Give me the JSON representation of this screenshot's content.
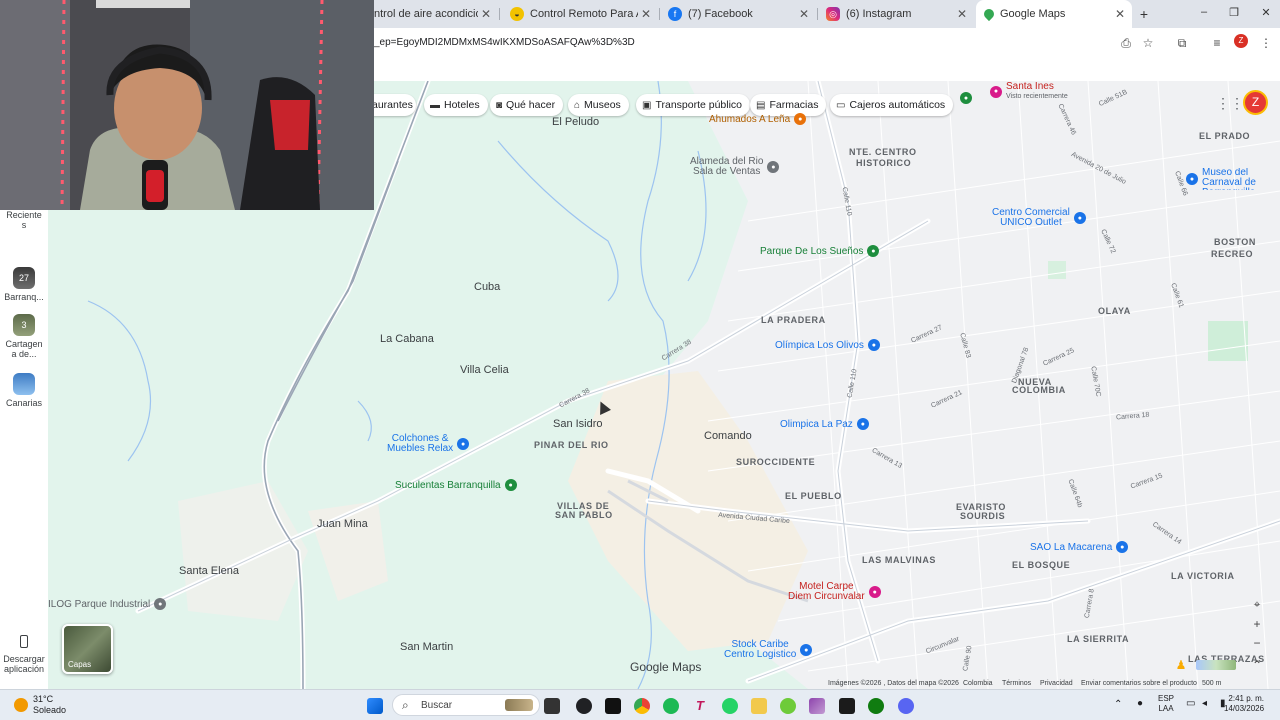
{
  "tabs": [
    {
      "label": "ntrol de aire acondicionado",
      "icon": "document-icon",
      "active": false
    },
    {
      "label": "Control Remoto Para Aire Acon",
      "icon": "shopping-icon",
      "active": false
    },
    {
      "label": "(7) Facebook",
      "icon": "facebook-icon",
      "active": false
    },
    {
      "label": "(6) Instagram",
      "icon": "instagram-icon",
      "active": false
    },
    {
      "label": "Google Maps",
      "icon": "maps-pin-icon",
      "active": true
    }
  ],
  "window": {
    "minimize": "–",
    "restore": "❐",
    "close": "✕",
    "new_tab": "+"
  },
  "omnibox": {
    "url": "_ep=EgoyMDI2MDMxMS4wIKXMDSoASAFQAw%3D%3D"
  },
  "profile_initial": "Z",
  "map": {
    "chips": [
      "aurantes",
      "Hoteles",
      "Qué hacer",
      "Museos",
      "Transporte público",
      "Farmacias",
      "Cajeros automáticos"
    ],
    "avatar_initial": "Z",
    "places": [
      "El Peludo",
      "Cuba",
      "La Cabana",
      "Villa Celia",
      "San Isidro",
      "Comando",
      "Juan Mina",
      "Santa Elena",
      "San Martin"
    ],
    "neighborhoods": [
      "NTE. CENTRO",
      "HISTORICO",
      "EL PRADO",
      "BOSTON",
      "RECREO",
      "OLAYA",
      "LA PRADERA",
      "NUEVA",
      "COLOMBIA",
      "PINAR DEL RIO",
      "SUROCCIDENTE",
      "EL PUEBLO",
      "VILLAS DE",
      "SAN PABLO",
      "EVARISTO",
      "SOURDIS",
      "LAS MALVINAS",
      "EL BOSQUE",
      "LA VICTORIA",
      "LA SIERRITA",
      "LAS TERRAZAS"
    ],
    "streets": [
      "Carrera 38",
      "Carrera 38",
      "Avenida Ciudad Caribe",
      "Calle 110",
      "Calle 110",
      "Carrera 27",
      "Carrera 21",
      "Calle 51B",
      "Carrera 46",
      "Avenida 20 de Julio",
      "Calle 72",
      "Calle 61",
      "Carrera 25",
      "Carrera 18",
      "Carrera 15",
      "Carrera 13",
      "Carrera 14",
      "Calle 64b",
      "Circunvalar",
      "Calle 90",
      "Carrera 8",
      "Calle 66",
      "Diagonal 78",
      "Calle 83",
      "Calle 70C"
    ],
    "pois": [
      {
        "name": "Santa Ines",
        "sub": "Visto recientemente",
        "color": "pink"
      },
      {
        "name": "Ahumados A Leña",
        "color": "brown"
      },
      {
        "name": "Alameda del Rio",
        "sub": "Sala de Ventas",
        "color": "grey"
      },
      {
        "name": "Museo del Carnaval de Barranquilla",
        "color": "blue"
      },
      {
        "name": "Centro Comercial",
        "sub": "UNICO Outlet",
        "color": "blue"
      },
      {
        "name": "Parque De Los Sueños",
        "color": "green"
      },
      {
        "name": "Olímpica Los Olivos",
        "color": "blue"
      },
      {
        "name": "Olimpica La Paz",
        "color": "blue"
      },
      {
        "name": "Colchones &",
        "sub": "Muebles Relax",
        "color": "blue"
      },
      {
        "name": "Suculentas Barranquilla",
        "color": "green"
      },
      {
        "name": "SAO La Macarena",
        "color": "blue"
      },
      {
        "name": "Motel Carpe",
        "sub": "Diem Circunvalar",
        "color": "pink"
      },
      {
        "name": "Stock Caribe",
        "sub": "Centro Logistico",
        "color": "blue"
      },
      {
        "name": "ILOG Parque Industrial",
        "color": "grey"
      }
    ],
    "logo": "Google Maps",
    "attribution": [
      "Imágenes ©2026 , Datos del mapa ©2026",
      "Colombia",
      "Términos",
      "Privacidad",
      "Enviar comentarios sobre el producto",
      "500 m"
    ],
    "layers_label": "Capas"
  },
  "sidebar": {
    "recent_label": "Reciente s",
    "items": [
      {
        "label": "Barranq...",
        "badge": "27"
      },
      {
        "label": "Cartagen a de...",
        "badge": "3"
      },
      {
        "label": "Canarias",
        "badge": ""
      }
    ],
    "download_label": "Descargar aplicación"
  },
  "taskbar": {
    "weather_temp": "31°C",
    "weather_desc": "Soleado",
    "search_placeholder": "Buscar",
    "lang_top": "ESP",
    "lang_bottom": "LAA",
    "time": "2:41 p. m.",
    "date": "14/03/2026"
  },
  "colors": {
    "accent": "#1a73e8",
    "map_bg": "#e2f4ec",
    "urban": "#eef0f2",
    "road": "#ffffff",
    "water": "#8ab4f8"
  }
}
